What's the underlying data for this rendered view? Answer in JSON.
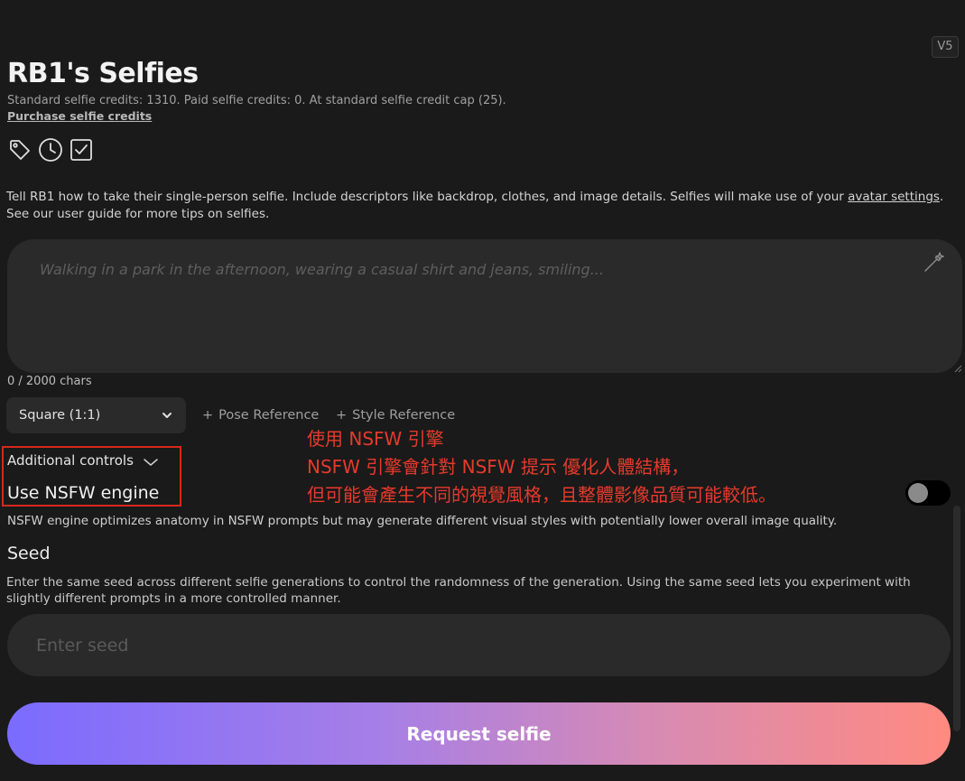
{
  "header": {
    "version_badge": "V5",
    "title": "RB1's Selfies",
    "credits_text": "Standard selfie credits: 1310. Paid selfie credits: 0. At standard selfie credit cap (25).",
    "purchase_link": "Purchase selfie credits"
  },
  "toolbar_icons": [
    "tag-icon",
    "clock-icon",
    "checkbox-icon"
  ],
  "instructions": {
    "before_link": "Tell RB1 how to take their single-person selfie. Include descriptors like backdrop, clothes, and image details. Selfies will make use of your ",
    "link_text": "avatar settings",
    "after_link": ". See our user guide for more tips on selfies."
  },
  "prompt": {
    "placeholder": "Walking in a park in the afternoon, wearing a casual shirt and jeans, smiling...",
    "value": "",
    "char_count": "0 / 2000 chars"
  },
  "options": {
    "aspect_ratio": "Square (1:1)",
    "pose_reference": "Pose Reference",
    "style_reference": "Style Reference",
    "plus_symbol": "+"
  },
  "additional_controls": {
    "label": "Additional controls",
    "nsfw_label": "Use NSFW engine",
    "nsfw_enabled": false,
    "nsfw_description": "NSFW engine optimizes anatomy in NSFW prompts but may generate different visual styles with potentially lower overall image quality."
  },
  "annotation": {
    "line1": "使用 NSFW 引擎",
    "line2": "NSFW 引擎會針對 NSFW 提示 優化人體結構，",
    "line3": "但可能會產生不同的視覺風格，且整體影像品質可能較低。",
    "color": "#e53a2c"
  },
  "seed": {
    "title": "Seed",
    "description": "Enter the same seed across different selfie generations to control the randomness of the generation. Using the same seed lets you experiment with slightly different prompts in a more controlled manner.",
    "placeholder": "Enter seed",
    "value": ""
  },
  "actions": {
    "request_label": "Request selfie"
  },
  "colors": {
    "background": "#1a1a1a",
    "input_bg": "#2a2a2a",
    "gradient_start": "#7b6bff",
    "gradient_end": "#ff8a80",
    "highlight": "#d8281c"
  }
}
